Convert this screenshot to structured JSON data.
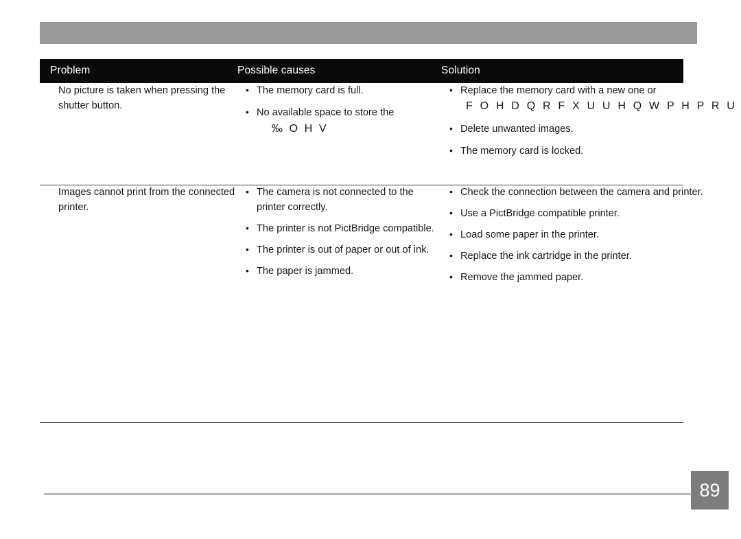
{
  "page": {
    "number": "89",
    "top_band": "decorative-gray-band"
  },
  "table": {
    "headers": {
      "problem": "Problem",
      "causes": "Possible causes",
      "solution": "Solution"
    },
    "rows": [
      {
        "problem": "No picture is taken when pressing the shutter button.",
        "causes": [
          "The memory card is full.",
          "No available space to  store the"
        ],
        "causes_garbled": "‰ O H V",
        "solutions": [
          "Replace the memory card with a new one or",
          "Delete unwanted images.",
          "The memory card is locked."
        ],
        "solutions_garbled": "F O H D Q  R    F X U U H Q W  P H P R U \\  F"
      },
      {
        "problem": "Images cannot print from the connected printer.",
        "causes": [
          "The camera is not connected to the printer correctly.",
          "The printer is not PictBridge compatible.",
          "The printer is out of paper or out  of ink.",
          "The paper is jammed."
        ],
        "solutions": [
          "Check the connection between the camera and printer.",
          "Use a PictBridge compatible printer.",
          "Load some paper in the printer.",
          "Replace the ink cartridge in the printer.",
          "Remove the jammed paper."
        ]
      }
    ]
  },
  "colors": {
    "header_bar": "#0a0a0a",
    "top_band": "#9a9a9a",
    "page_box": "#7d7d7d",
    "footer_rule": "#b7b7b7",
    "text": "#161616"
  }
}
